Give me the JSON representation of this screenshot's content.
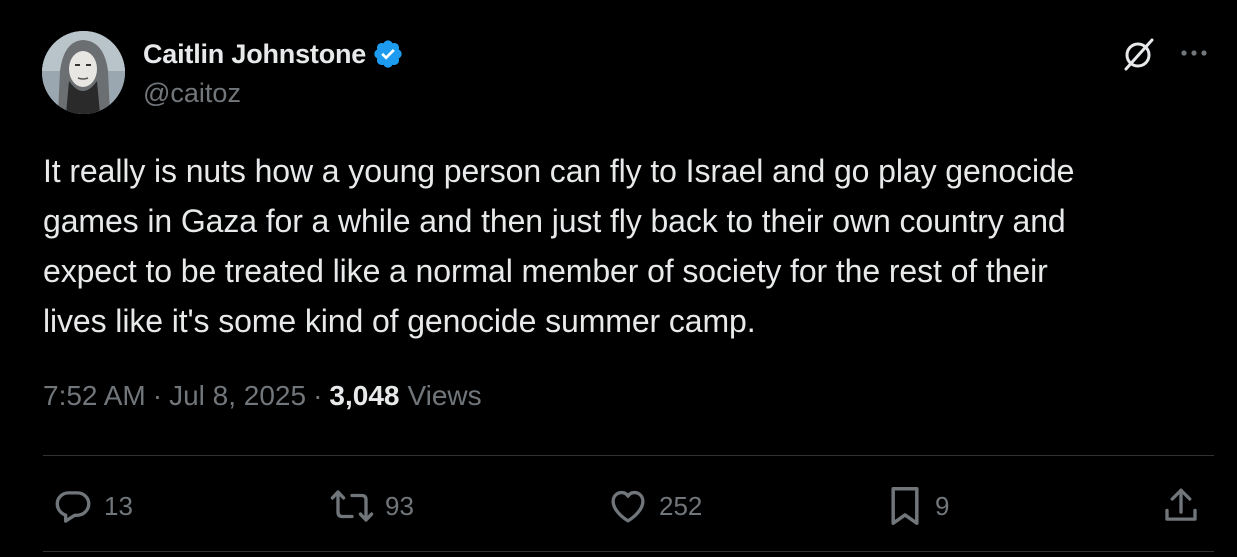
{
  "author": {
    "display_name": "Caitlin Johnstone",
    "handle": "@caitoz",
    "verified": true,
    "verified_color": "#1d9bf0"
  },
  "header_icons": [
    "grok-icon",
    "more-icon"
  ],
  "tweet": {
    "text": "It really is nuts how a young person can fly to Israel and go play genocide\ngames in Gaza for a while and then just fly back to their own country and\nexpect to be treated like a normal member of society for the rest of their\nlives like it's some kind of genocide summer camp."
  },
  "meta": {
    "time": "7:52 AM",
    "date": "Jul 8, 2025",
    "separator": "·",
    "views_count": "3,048",
    "views_label": "Views"
  },
  "actions": {
    "reply": {
      "icon": "reply-icon",
      "count": "13"
    },
    "retweet": {
      "icon": "retweet-icon",
      "count": "93"
    },
    "like": {
      "icon": "heart-icon",
      "count": "252"
    },
    "bookmark": {
      "icon": "bookmark-icon",
      "count": "9"
    },
    "share": {
      "icon": "share-icon"
    }
  },
  "colors": {
    "background": "#000000",
    "text_primary": "#e7e9ea",
    "text_secondary": "#71767b",
    "divider": "#2f3336"
  }
}
